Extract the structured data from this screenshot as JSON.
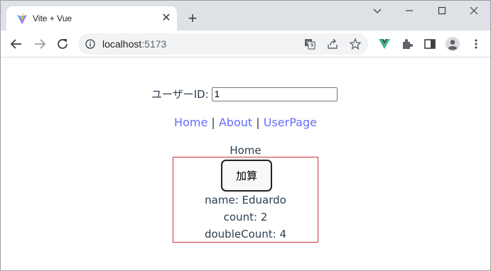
{
  "browser": {
    "tab_title": "Vite + Vue",
    "tab_close": "✕",
    "new_tab": "+",
    "url_host": "localhost",
    "url_port": ":5173",
    "window_controls": {
      "minimize": "—",
      "maximize": "☐",
      "close": "✕"
    },
    "icons": [
      "vite-favicon",
      "back-arrow-icon",
      "forward-arrow-icon",
      "reload-icon",
      "site-info-icon",
      "translate-icon",
      "share-icon",
      "bookmark-star-icon",
      "vue-devtools-icon",
      "extensions-icon",
      "side-panel-icon",
      "profile-icon",
      "menu-icon"
    ]
  },
  "page": {
    "user_id_label": "ユーザーID:",
    "user_id_value": "1",
    "nav": {
      "home": "Home",
      "separator": "|",
      "about": "About",
      "userpage": "UserPage"
    },
    "view_title": "Home",
    "calc_button": "加算",
    "name_line": "name: Eduardo",
    "count_line": "count: 2",
    "double_count_line": "doubleCount: 4"
  },
  "colors": {
    "link": "#646cff",
    "box_border": "#d0303a",
    "vue_green": "#41b883"
  }
}
